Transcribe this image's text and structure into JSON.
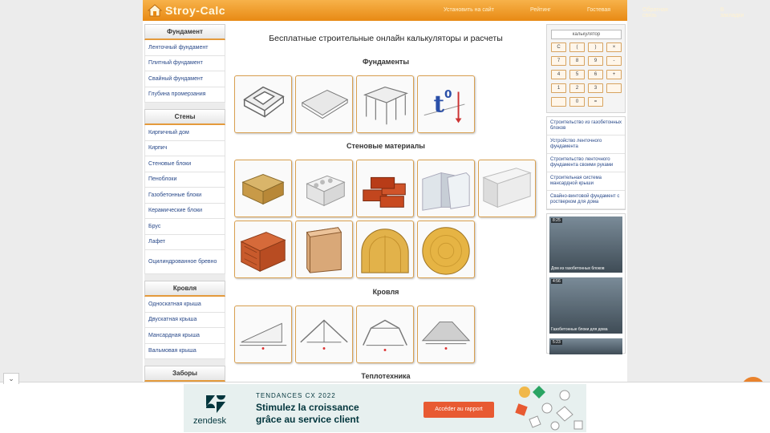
{
  "header": {
    "logo": "Stroy-Calc",
    "nav": [
      "Установить на сайт",
      "Рейтинг",
      "Гостевая",
      "Обратная связь",
      "В закладки"
    ]
  },
  "left_sidebar": {
    "sections": [
      {
        "title": "Фундамент",
        "links": [
          "Ленточный фундамент",
          "Плитный фундамент",
          "Свайный фундамент",
          "Глубина промерзания"
        ]
      },
      {
        "title": "Стены",
        "links": [
          "Кирпичный дом",
          "Кирпич",
          "Стеновые блоки",
          "Пеноблоки",
          "Газобетонные блоки",
          "Керамические блоки",
          "Брус",
          "Лафет",
          "Оцилиндрованное бревно"
        ]
      },
      {
        "title": "Кровля",
        "links": [
          "Односкатная крыша",
          "Двускатная крыша",
          "Мансардная крыша",
          "Вальмовая крыша"
        ]
      },
      {
        "title": "Заборы",
        "links": []
      }
    ]
  },
  "main": {
    "title": "Бесплатные строительные онлайн калькуляторы и расчеты",
    "sections": [
      "Фундаменты",
      "Стеновые материалы",
      "Кровля",
      "Теплотехника"
    ]
  },
  "calculator": {
    "display": "калькулятор",
    "keys": [
      "C",
      "(",
      ")",
      "×",
      "7",
      "8",
      "9",
      "-",
      "4",
      "5",
      "6",
      "+",
      "1",
      "2",
      "3",
      "",
      "",
      "0",
      "=",
      ""
    ]
  },
  "right_links": [
    "Строительство из газобетонных блоков",
    "Устройство ленточного фундамента",
    "Строительство ленточного фундамента своими руками",
    "Строительная система мансардной крыши",
    "Свайно-винтовой фундамент с ростверком для дома"
  ],
  "videos": [
    {
      "duration": "8:25",
      "title": "Дом из газобетонных блоков"
    },
    {
      "duration": "4:56",
      "title": "Газобетонные блоки для дома"
    },
    {
      "duration": "5:23",
      "title": ""
    }
  ],
  "ad": {
    "brand": "zendesk",
    "kicker": "TENDANCES CX 2022",
    "headline1": "Stimulez la croissance",
    "headline2": "grâce au service client",
    "button": "Accéder au rapport",
    "close": "⌄"
  }
}
